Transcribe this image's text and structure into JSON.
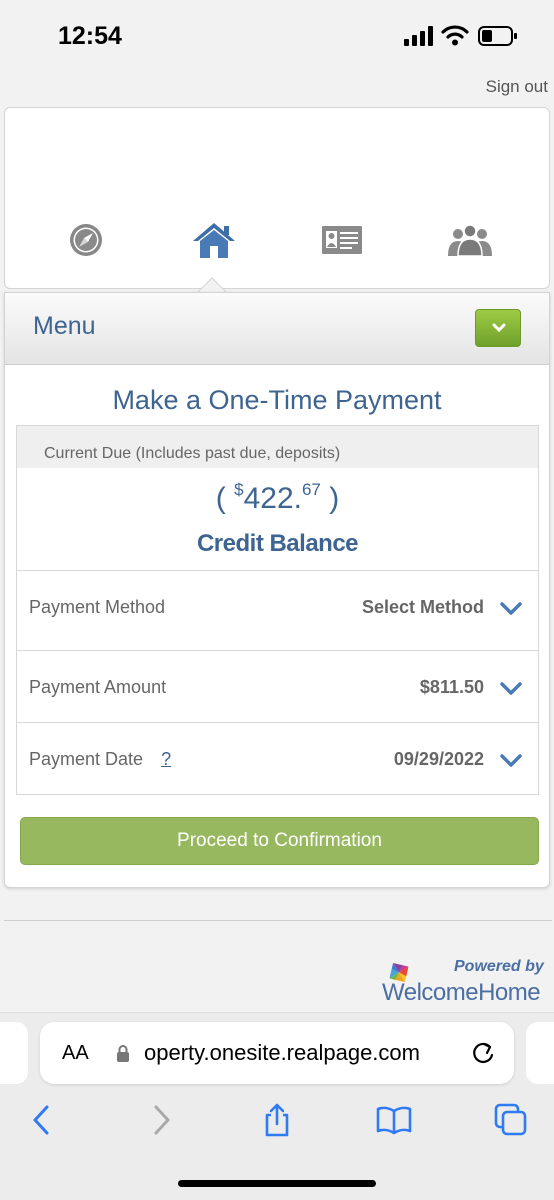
{
  "status_bar": {
    "time": "12:54"
  },
  "header": {
    "sign_out": "Sign out"
  },
  "nav": {
    "icons": [
      "compass-icon",
      "home-icon",
      "id-card-icon",
      "group-icon"
    ]
  },
  "menu": {
    "label": "Menu"
  },
  "payment": {
    "title": "Make a One-Time Payment",
    "due_label": "Current Due (Includes past due, deposits)",
    "balance_open": "(",
    "balance_currency": "$",
    "balance_whole": "422.",
    "balance_cents": "67",
    "balance_close": ")",
    "balance_status": "Credit Balance",
    "method_label": "Payment Method",
    "method_value": "Select Method",
    "amount_label": "Payment Amount",
    "amount_value": "$811.50",
    "date_label": "Payment Date",
    "date_help": "?",
    "date_value": "09/29/2022",
    "proceed_label": "Proceed to Confirmation"
  },
  "footer": {
    "powered_by": "Powered by",
    "brand": "WelcomeHome"
  },
  "browser": {
    "aa_label": "AA",
    "url": "operty.onesite.realpage.com"
  },
  "colors": {
    "accent_blue": "#3e6491",
    "menu_green": "#7fb035",
    "proceed_green": "#98b860"
  }
}
